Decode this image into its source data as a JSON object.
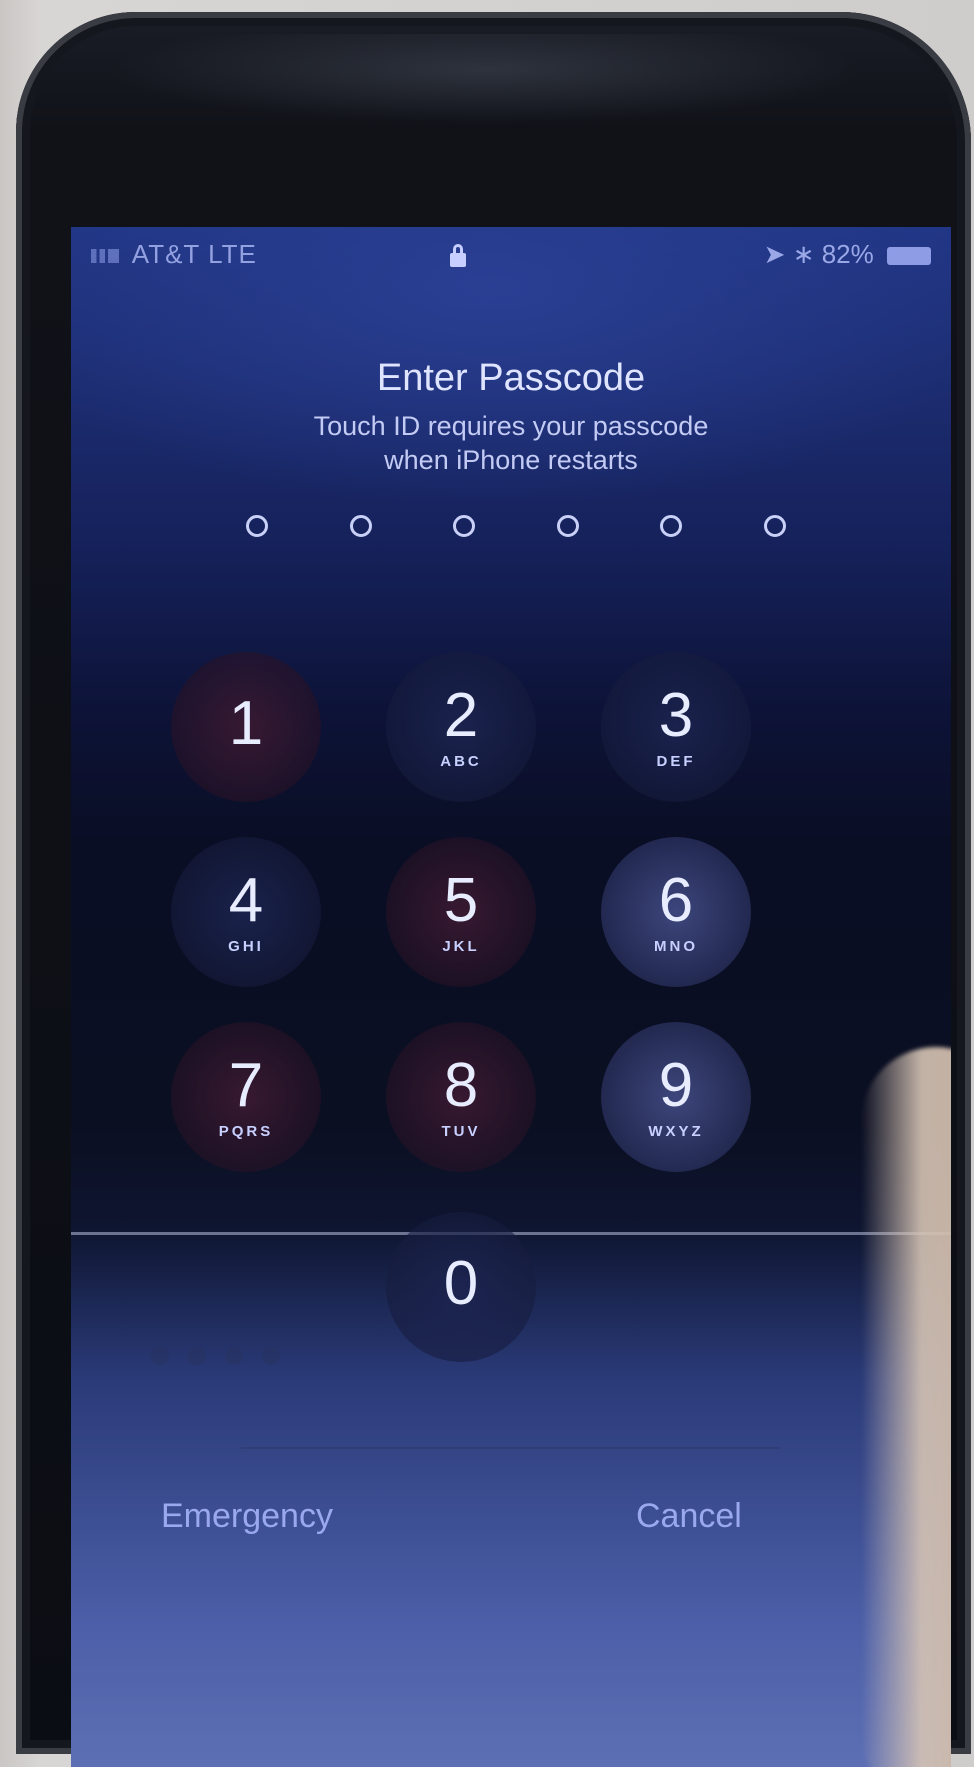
{
  "status_bar": {
    "carrier": "AT&T",
    "network": "LTE",
    "battery_text": "82%"
  },
  "lock_screen": {
    "title": "Enter Passcode",
    "subtitle_line1": "Touch ID requires your passcode",
    "subtitle_line2": "when iPhone restarts",
    "passcode_length": 6
  },
  "keypad": [
    {
      "num": "1",
      "letters": ""
    },
    {
      "num": "2",
      "letters": "ABC"
    },
    {
      "num": "3",
      "letters": "DEF"
    },
    {
      "num": "4",
      "letters": "GHI"
    },
    {
      "num": "5",
      "letters": "JKL"
    },
    {
      "num": "6",
      "letters": "MNO"
    },
    {
      "num": "7",
      "letters": "PQRS"
    },
    {
      "num": "8",
      "letters": "TUV"
    },
    {
      "num": "9",
      "letters": "WXYZ"
    },
    {
      "num": "0",
      "letters": ""
    }
  ],
  "footer": {
    "left_button": "Emergency",
    "right_button": "Cancel"
  },
  "colors": {
    "screen_blue": "#203584",
    "text_light": "#dfe4ff",
    "button_text": "#9aa8ee"
  }
}
